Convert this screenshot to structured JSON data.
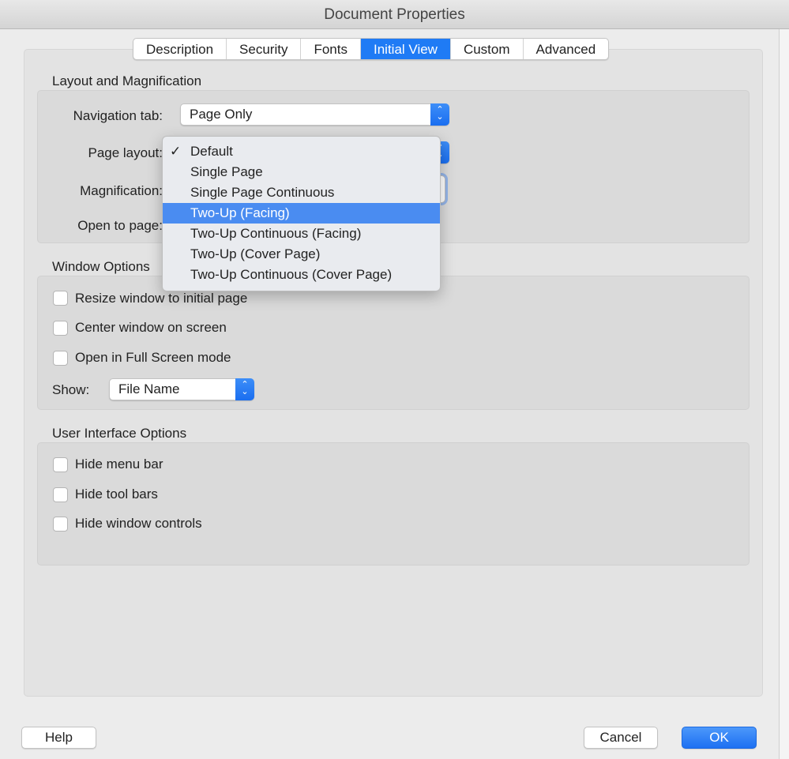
{
  "window": {
    "title": "Document Properties"
  },
  "tabs": [
    {
      "label": "Description"
    },
    {
      "label": "Security"
    },
    {
      "label": "Fonts"
    },
    {
      "label": "Initial View",
      "active": true
    },
    {
      "label": "Custom"
    },
    {
      "label": "Advanced"
    }
  ],
  "layout": {
    "title": "Layout and Magnification",
    "navigation_tab_label": "Navigation tab:",
    "navigation_tab_value": "Page Only",
    "page_layout_label": "Page layout:",
    "magnification_label": "Magnification:",
    "open_to_page_label": "Open to page:"
  },
  "page_layout_menu": {
    "items": [
      {
        "label": "Default",
        "checked": true
      },
      {
        "label": "Single Page"
      },
      {
        "label": "Single Page Continuous"
      },
      {
        "label": "Two-Up (Facing)",
        "highlighted": true
      },
      {
        "label": "Two-Up Continuous (Facing)"
      },
      {
        "label": "Two-Up (Cover Page)"
      },
      {
        "label": "Two-Up Continuous (Cover Page)"
      }
    ],
    "check_glyph": "✓"
  },
  "window_options": {
    "title": "Window Options",
    "checkboxes": [
      {
        "label": "Resize window to initial page",
        "checked": false
      },
      {
        "label": "Center window on screen",
        "checked": false
      },
      {
        "label": "Open in Full Screen mode",
        "checked": false
      }
    ],
    "show_label": "Show:",
    "show_value": "File Name"
  },
  "ui_options": {
    "title": "User Interface Options",
    "checkboxes": [
      {
        "label": "Hide menu bar",
        "checked": false
      },
      {
        "label": "Hide tool bars",
        "checked": false
      },
      {
        "label": "Hide window controls",
        "checked": false
      }
    ]
  },
  "buttons": {
    "help": "Help",
    "cancel": "Cancel",
    "ok": "OK"
  },
  "colors": {
    "accent": "#1f7bf5",
    "highlight": "#4a8cf1"
  }
}
